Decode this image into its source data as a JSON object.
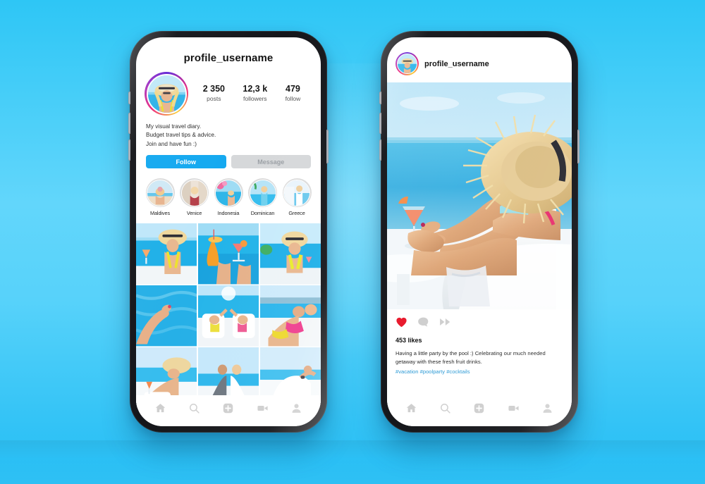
{
  "background": {
    "color_top": "#2ec6f5",
    "color_mid": "#62d6fb",
    "color_bottom": "#25bdf4"
  },
  "theme": {
    "accent_blue": "#14a9f0",
    "link_blue": "#2e9bd6",
    "heart_red": "#e8192c",
    "muted_gray": "#cfcfcf",
    "message_btn_bg": "#d6d8da"
  },
  "left_phone": {
    "name": "instagram-profile-screen",
    "header_title": "profile_username",
    "avatar": {
      "name": "profile-avatar",
      "alt": "blonde woman in straw hat by the sea"
    },
    "stats": [
      {
        "number": "2 350",
        "label": "posts"
      },
      {
        "number": "12,3 k",
        "label": "followers"
      },
      {
        "number": "479",
        "label": "follow"
      }
    ],
    "bio_lines": [
      "My visual travel diary.",
      "Budget travel tips & advice.",
      "Join and have fun :)"
    ],
    "buttons": {
      "follow": "Follow",
      "message": "Message"
    },
    "highlights": [
      {
        "name": "Maldives"
      },
      {
        "name": "Venice"
      },
      {
        "name": "Indonesia"
      },
      {
        "name": "Dominican"
      },
      {
        "name": "Greece"
      }
    ],
    "grid": [
      {
        "alt": "woman toasting cocktail by infinity pool"
      },
      {
        "alt": "two fruit cocktails clinking over pool"
      },
      {
        "alt": "woman in yellow bikini and straw hat at pool bar"
      },
      {
        "alt": "legs with red pedicure over turquoise pool water"
      },
      {
        "alt": "couple on sun loungers toasting by the pool"
      },
      {
        "alt": "couple sunbathing on lounger in pink and yellow swimwear"
      },
      {
        "alt": "woman in straw hat with cocktail on white lounger"
      },
      {
        "alt": "couple meditating on terrace facing the sea"
      },
      {
        "alt": "woman in white doing yoga by the sea"
      }
    ],
    "tabbar": [
      {
        "icon": "home-icon",
        "label": "Home"
      },
      {
        "icon": "search-icon",
        "label": "Search"
      },
      {
        "icon": "add-post-icon",
        "label": "Create"
      },
      {
        "icon": "reels-icon",
        "label": "Reels"
      },
      {
        "icon": "profile-icon",
        "label": "Profile"
      }
    ]
  },
  "right_phone": {
    "name": "instagram-post-screen",
    "post": {
      "username": "profile_username",
      "avatar": {
        "name": "post-author-avatar",
        "alt": "blonde woman in straw hat"
      },
      "media": {
        "alt": "woman in straw hat reclining on lounger holding a cocktail by the sea"
      },
      "likes": "453 likes",
      "caption": "Having a little party by the pool :) Celebrating our much needed getaway with these fresh fruit drinks.",
      "hashtags": "#vacation #poolparty #cocktails",
      "actions": [
        {
          "icon": "heart-icon",
          "label": "Like",
          "state": "liked"
        },
        {
          "icon": "comment-icon",
          "label": "Comment",
          "state": "default"
        },
        {
          "icon": "share-icon",
          "label": "Share",
          "state": "default"
        }
      ]
    },
    "tabbar": [
      {
        "icon": "home-icon",
        "label": "Home"
      },
      {
        "icon": "search-icon",
        "label": "Search"
      },
      {
        "icon": "add-post-icon",
        "label": "Create"
      },
      {
        "icon": "reels-icon",
        "label": "Reels"
      },
      {
        "icon": "profile-icon",
        "label": "Profile"
      }
    ]
  }
}
